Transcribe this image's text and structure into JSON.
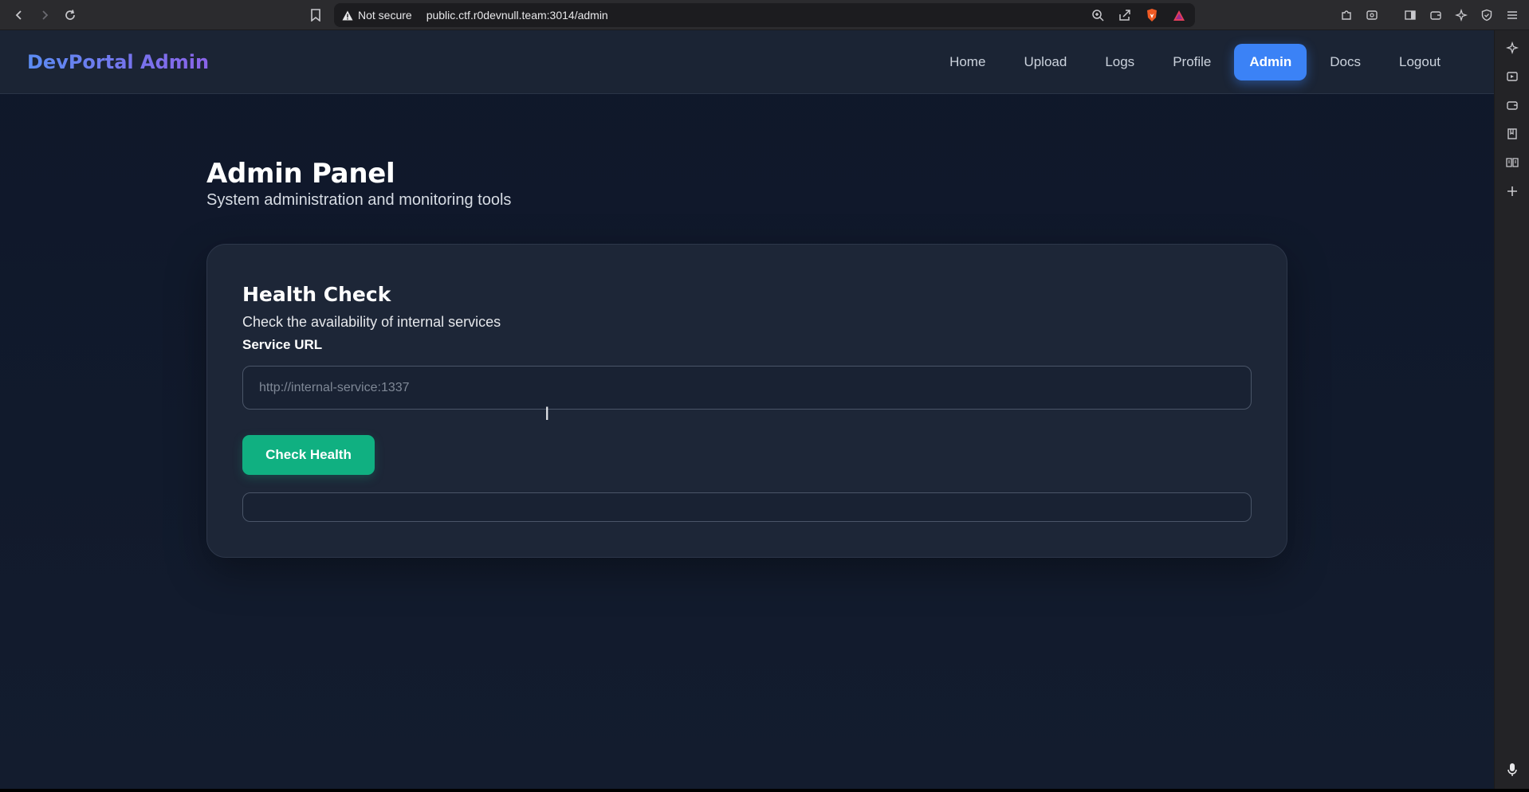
{
  "browser": {
    "security_label": "Not secure",
    "url": "public.ctf.r0devnull.team:3014/admin"
  },
  "app": {
    "brand": "DevPortal Admin",
    "nav": [
      {
        "label": "Home"
      },
      {
        "label": "Upload"
      },
      {
        "label": "Logs"
      },
      {
        "label": "Profile"
      },
      {
        "label": "Admin",
        "active": true
      },
      {
        "label": "Docs"
      },
      {
        "label": "Logout"
      }
    ]
  },
  "page": {
    "title": "Admin Panel",
    "subtitle": "System administration and monitoring tools"
  },
  "health_check": {
    "title": "Health Check",
    "description": "Check the availability of internal services",
    "field_label": "Service URL",
    "input_placeholder": "http://internal-service:1337",
    "input_value": "",
    "button_label": "Check Health",
    "result_text": ""
  },
  "colors": {
    "accent": "#3b82f6",
    "success_button": "#10b081",
    "background": "#111827"
  }
}
